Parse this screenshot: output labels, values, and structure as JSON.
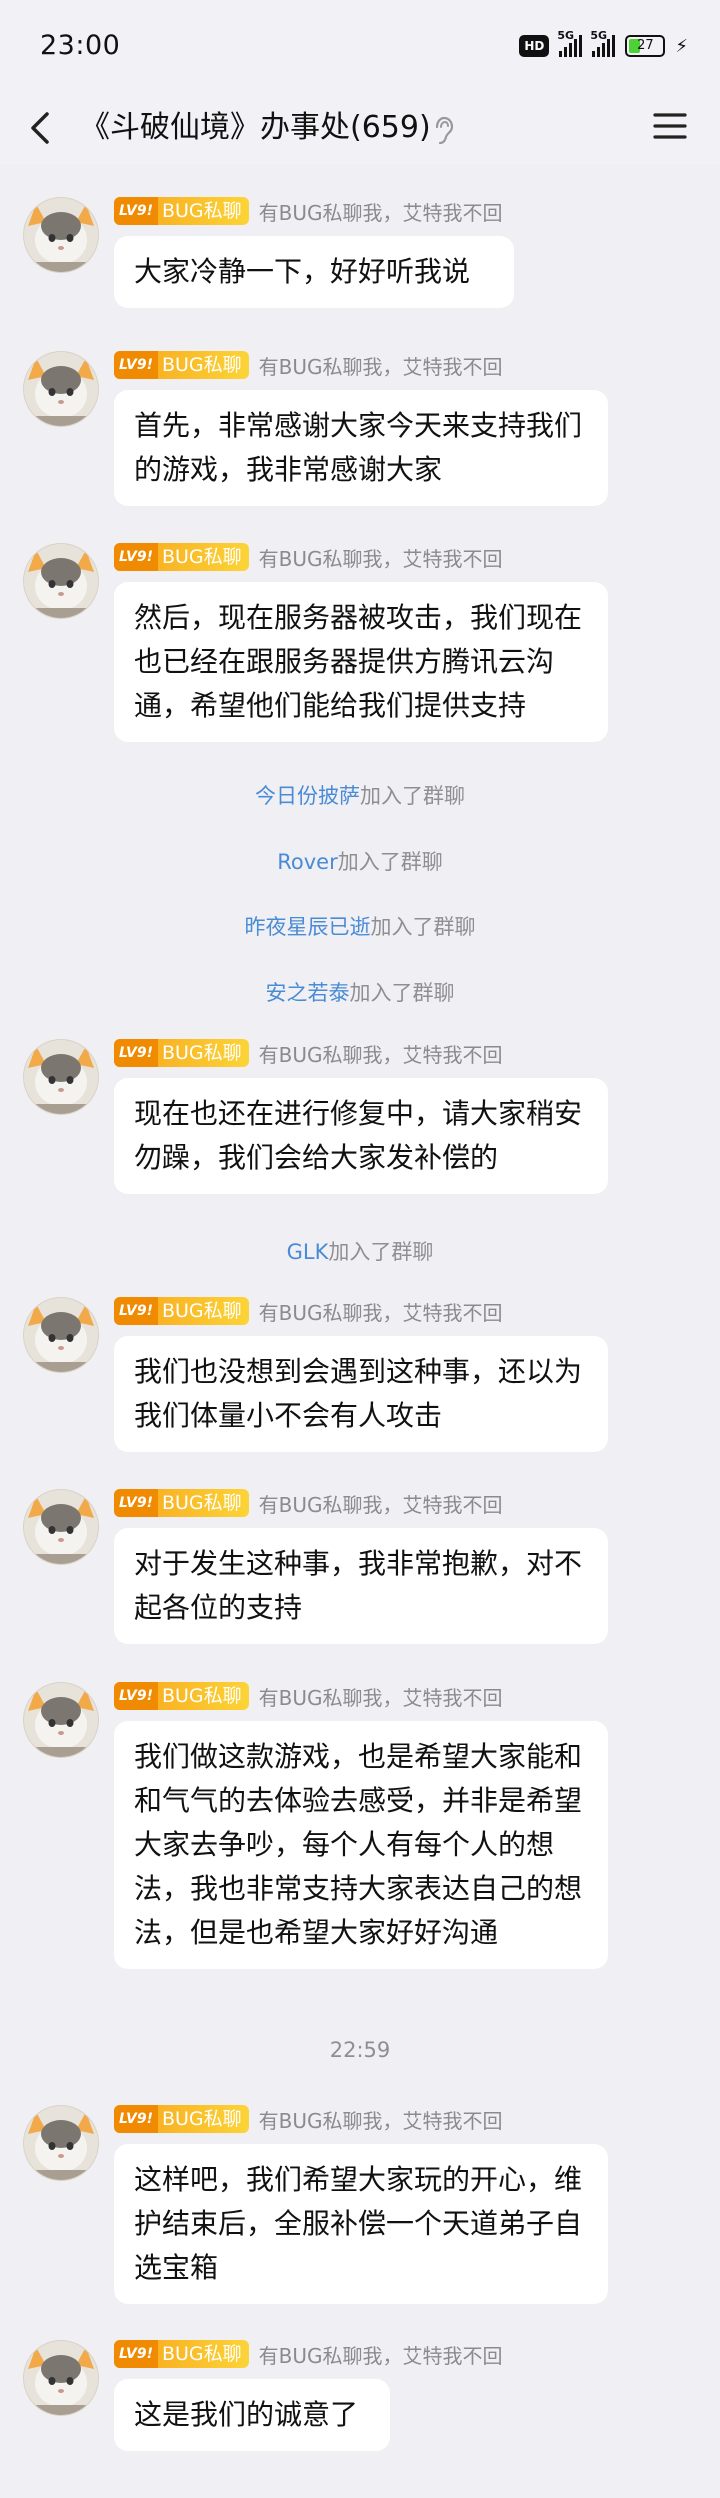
{
  "status": {
    "time": "23:00",
    "hd": "HD",
    "net1": "5G",
    "net2": "5G",
    "battery": "27"
  },
  "header": {
    "title": "《斗破仙境》办事处(659)"
  },
  "sender": {
    "level": "LV9!",
    "title": "BUG私聊",
    "nickname": "有BUG私聊我，艾特我不回"
  },
  "messages": [
    {
      "text": "大家冷静一下，好好听我说"
    },
    {
      "text": "首先，非常感谢大家今天来支持我们的游戏，我非常感谢大家"
    },
    {
      "text": "然后，现在服务器被攻击，我们现在也已经在跟服务器提供方腾讯云沟通，希望他们能给我们提供支持"
    },
    {
      "text": "现在也还在进行修复中，请大家稍安勿躁，我们会给大家发补偿的"
    },
    {
      "text": "我们也没想到会遇到这种事，还以为我们体量小不会有人攻击"
    },
    {
      "text": "对于发生这种事，我非常抱歉，对不起各位的支持"
    },
    {
      "text": "我们做这款游戏，也是希望大家能和和气气的去体验去感受，并非是希望大家去争吵，每个人有每个人的想法，我也非常支持大家表达自己的想法，但是也希望大家好好沟通"
    },
    {
      "text": "这样吧，我们希望大家玩的开心，维护结束后，全服补偿一个天道弟子自选宝箱"
    },
    {
      "text": "这是我们的诚意了"
    }
  ],
  "joins": [
    {
      "name": "今日份披萨",
      "suffix": "加入了群聊"
    },
    {
      "name": "Rover",
      "suffix": "加入了群聊"
    },
    {
      "name": "昨夜星辰已逝",
      "suffix": "加入了群聊"
    },
    {
      "name": "安之若泰",
      "suffix": "加入了群聊"
    },
    {
      "name": "GLK",
      "suffix": "加入了群聊"
    }
  ],
  "timestamp": "22:59"
}
